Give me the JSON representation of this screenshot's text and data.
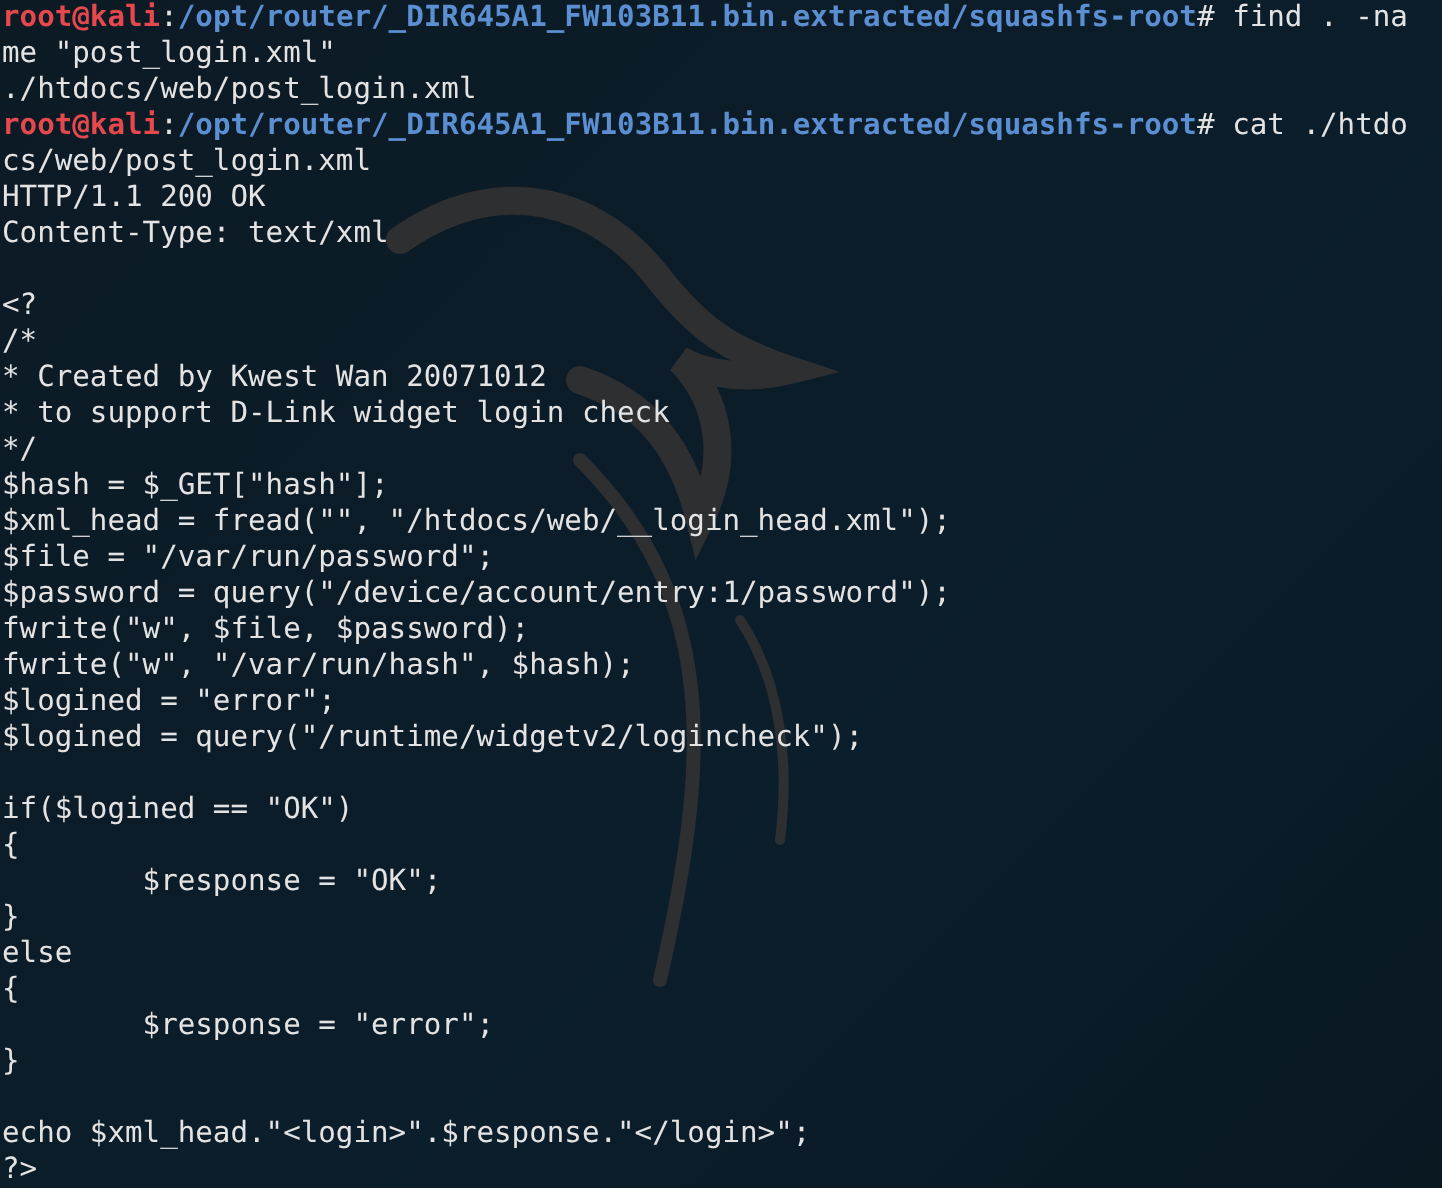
{
  "terminal": {
    "lines": [
      {
        "kind": "prompt",
        "user": "root@kali",
        "separator": ":",
        "path": "/opt/router/_DIR645A1_FW103B11.bin.extracted/squashfs-root",
        "symbol": "#",
        "command": "find . -na"
      },
      {
        "kind": "output",
        "text": "me \"post_login.xml\""
      },
      {
        "kind": "output",
        "text": "./htdocs/web/post_login.xml"
      },
      {
        "kind": "prompt",
        "user": "root@kali",
        "separator": ":",
        "path": "/opt/router/_DIR645A1_FW103B11.bin.extracted/squashfs-root",
        "symbol": "#",
        "command": "cat ./htdo"
      },
      {
        "kind": "output",
        "text": "cs/web/post_login.xml"
      },
      {
        "kind": "output",
        "text": "HTTP/1.1 200 OK"
      },
      {
        "kind": "output",
        "text": "Content-Type: text/xml"
      },
      {
        "kind": "blank"
      },
      {
        "kind": "output",
        "text": "<?"
      },
      {
        "kind": "output",
        "text": "/*"
      },
      {
        "kind": "output",
        "text": "* Created by Kwest Wan 20071012"
      },
      {
        "kind": "output",
        "text": "* to support D-Link widget login check"
      },
      {
        "kind": "output",
        "text": "*/"
      },
      {
        "kind": "output",
        "text": "$hash = $_GET[\"hash\"];"
      },
      {
        "kind": "output",
        "text": "$xml_head = fread(\"\", \"/htdocs/web/__login_head.xml\");"
      },
      {
        "kind": "output",
        "text": "$file = \"/var/run/password\";"
      },
      {
        "kind": "output",
        "text": "$password = query(\"/device/account/entry:1/password\");"
      },
      {
        "kind": "output",
        "text": "fwrite(\"w\", $file, $password);"
      },
      {
        "kind": "output",
        "text": "fwrite(\"w\", \"/var/run/hash\", $hash);"
      },
      {
        "kind": "output",
        "text": "$logined = \"error\";"
      },
      {
        "kind": "output",
        "text": "$logined = query(\"/runtime/widgetv2/logincheck\");"
      },
      {
        "kind": "blank"
      },
      {
        "kind": "output",
        "text": "if($logined == \"OK\")"
      },
      {
        "kind": "output",
        "text": "{"
      },
      {
        "kind": "output",
        "text": "        $response = \"OK\";"
      },
      {
        "kind": "output",
        "text": "}"
      },
      {
        "kind": "output",
        "text": "else"
      },
      {
        "kind": "output",
        "text": "{"
      },
      {
        "kind": "output",
        "text": "        $response = \"error\";"
      },
      {
        "kind": "output",
        "text": "}"
      },
      {
        "kind": "blank"
      },
      {
        "kind": "output",
        "text": "echo $xml_head.\"<login>\".$response.\"</login>\";"
      },
      {
        "kind": "output",
        "text": "?>"
      }
    ]
  }
}
